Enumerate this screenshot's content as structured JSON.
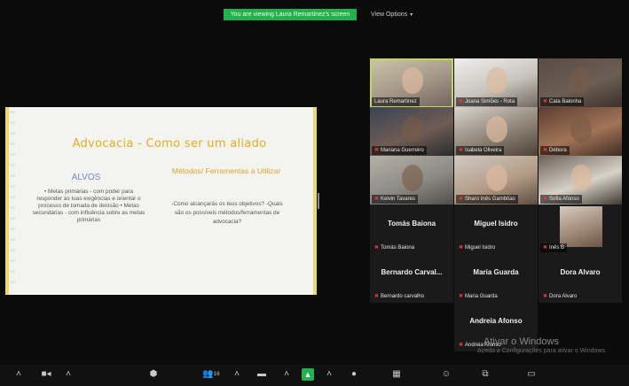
{
  "topbar": {
    "viewing_banner": "You are viewing Laura Remartinez's screen",
    "view_options": "View Options"
  },
  "slide": {
    "title": "Advocacia - Como ser um aliado",
    "col_a_title": "ALVOS",
    "col_a_text": "• Metas primárias - com poder para responder às tuas exigências e orientar o processo de tomada de decisão • Metas secundárias - com influência sobre as metas primárias",
    "col_b_title": "Métodos/ Ferramentas a Utilizar",
    "col_b_text": "-Como alcançarás os teus objetivos? -Quais são os possíveis métodos/ferramentas de advocacia?"
  },
  "participants": [
    {
      "label": "Laura Remartinez",
      "video": true
    },
    {
      "label": "Joana Simões - Rota",
      "video": true
    },
    {
      "label": "Cata Balonha",
      "video": true
    },
    {
      "label": "Mariana Guerreiro",
      "video": true
    },
    {
      "label": "Isabela Oliveira",
      "video": true
    },
    {
      "label": "Débora",
      "video": true
    },
    {
      "label": "Kelvin Tavares",
      "video": true
    },
    {
      "label": "Sharo Inês Gambôas",
      "video": true
    },
    {
      "label": "Sofia Afonso",
      "video": true
    },
    {
      "name": "Tomás Baiona",
      "label": "Tomás Baiona",
      "video": false
    },
    {
      "name": "Miguel Isidro",
      "label": "Miguel Isidro",
      "video": false
    },
    {
      "label": "Inês B",
      "video": false,
      "photo": true
    },
    {
      "name": "Bernardo Carval...",
      "label": "Bernardo carvalho",
      "video": false
    },
    {
      "name": "Maria Guarda",
      "label": "Maria Guarda",
      "video": false
    },
    {
      "name": "Dora Alvaro",
      "label": "Dora Alvaro",
      "video": false
    },
    {
      "name": "Andreia Afonso",
      "label": "Andreia Afonso",
      "video": false
    }
  ],
  "watermark": {
    "line1": "Ativar o Windows",
    "line2": "Aceda a Configurações para ativar o Windows."
  },
  "toolbar": {
    "participants_count": "16",
    "icons": [
      "chevron-up-icon",
      "camera-icon",
      "chevron-up-icon",
      "security-icon",
      "participants-icon",
      "chat-icon",
      "share-screen-icon",
      "chevron-up-icon",
      "record-icon",
      "gallery-icon",
      "reactions-icon",
      "apps-icon",
      "whiteboard-icon"
    ]
  },
  "colors": {
    "banner_green": "#22b14c",
    "slide_accent": "#f0cf42",
    "active_speaker": "#c7d45a",
    "muted_red": "#e33b3b"
  }
}
